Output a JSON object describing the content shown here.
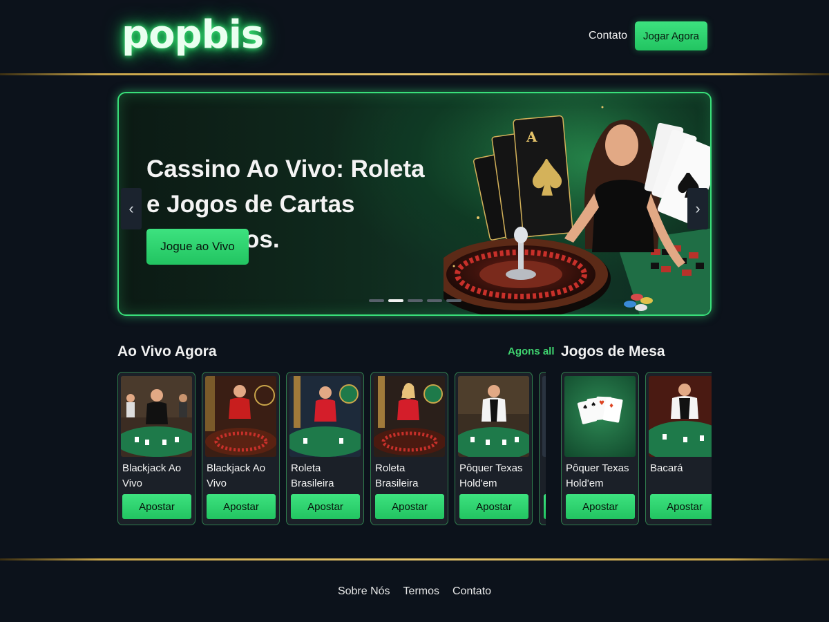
{
  "header": {
    "logo": "popbis",
    "nav_contact": "Contato",
    "play_now": "Jogar Agora"
  },
  "hero": {
    "title": "Cassino Ao Vivo: Roleta e Jogos de Cartas Exclusivos.",
    "cta": "Jogue ao Vivo",
    "prev_icon": "chevron-left-icon",
    "next_icon": "chevron-right-icon",
    "slides": 5,
    "active_slide": 2
  },
  "live": {
    "title": "Ao Vivo Agora",
    "see_all": "Agons all",
    "cards": [
      {
        "label": "Blackjack Ao Vivo",
        "button": "Apostar"
      },
      {
        "label": "Blackjack Ao Vivo",
        "button": "Apostar"
      },
      {
        "label": "Roleta Brasileira",
        "button": "Apostar"
      },
      {
        "label": "Roleta Brasileira",
        "button": "Apostar"
      },
      {
        "label": "Pôquer Texas Hold'em",
        "button": "Apostar"
      }
    ]
  },
  "table_games": {
    "title": "Jogos de Mesa",
    "cards": [
      {
        "label": "Pôquer Texas Hold'em",
        "button": "Apostar"
      },
      {
        "label": "Bacará",
        "button": "Apostar"
      }
    ]
  },
  "footer": {
    "links": [
      "Sobre Nós",
      "Termos",
      "Contato"
    ]
  },
  "colors": {
    "background": "#0c121b",
    "accent": "#34d675",
    "gold": "#c9a54a"
  }
}
